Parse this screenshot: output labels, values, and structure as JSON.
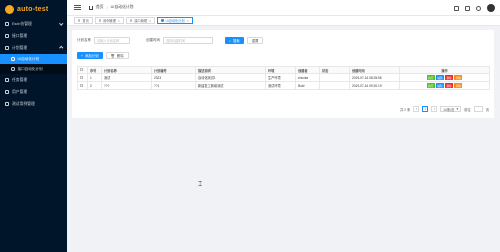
{
  "app": {
    "logo_text": "auto-test",
    "brand_color": "#f5a623",
    "accent_color": "#1890ff"
  },
  "sidebar": {
    "items": [
      {
        "label": "Esxb仿管理",
        "icon": "home-icon"
      },
      {
        "label": "接口管理",
        "icon": "api-icon"
      },
      {
        "label": "计划管理",
        "icon": "plan-icon",
        "expanded": true
      }
    ],
    "sub_items": [
      {
        "label": "UI自动化计划",
        "active": true
      },
      {
        "label": "接口自动化计划",
        "active": false
      }
    ],
    "more_items": [
      {
        "label": "任务管理",
        "icon": "task-icon"
      },
      {
        "label": "用户管理",
        "icon": "user-icon"
      },
      {
        "label": "测试用例管理",
        "icon": "case-icon"
      }
    ]
  },
  "header": {
    "breadcrumb": [
      "首页",
      "UI自动化计划"
    ],
    "tools": [
      "lock-icon",
      "fullscreen-icon",
      "bell-icon"
    ]
  },
  "tabs": [
    {
      "label": "首页",
      "active": false
    },
    {
      "label": "用例管理",
      "active": false
    },
    {
      "label": "接口管理",
      "active": false
    },
    {
      "label": "UI自动化计划",
      "active": true
    }
  ],
  "search": {
    "name_label": "计划名称",
    "name_placeholder": "请输入计划名称",
    "time_label": "创建时间",
    "time_placeholder": "选择创建时间",
    "search_button": "搜索",
    "reset_button": "重置"
  },
  "actions": {
    "add_button": "添加计划",
    "delete_button": "删除"
  },
  "table": {
    "headers": [
      "",
      "序号",
      "计划名称",
      "计划编号",
      "描述说明",
      "环境",
      "创建者",
      "状态",
      "创建时间",
      "操作"
    ],
    "rows": [
      {
        "index": "1",
        "name": "测试",
        "code": "2323",
        "desc": "自动化测试1",
        "env": "生产环境",
        "creator": "zhuoke",
        "status": "",
        "created": "2019-07-16 08:25:56"
      },
      {
        "index": "2",
        "name": "???",
        "code": "??1",
        "desc": "新建复工新增测试",
        "env": "测试环境",
        "creator": "Bold",
        "status": "",
        "created": "2019-07-16 09:20:19"
      }
    ],
    "ops": [
      {
        "label": "执行",
        "color": "#52c41a"
      },
      {
        "label": "编辑",
        "color": "#1890ff"
      },
      {
        "label": "删除",
        "color": "#f5222d"
      },
      {
        "label": "详情",
        "color": "#fa8c16"
      }
    ]
  },
  "pager": {
    "total": "共 2 条",
    "current": "1",
    "page_size": "10条/页",
    "goto_label": "前往",
    "page_unit": "页"
  }
}
